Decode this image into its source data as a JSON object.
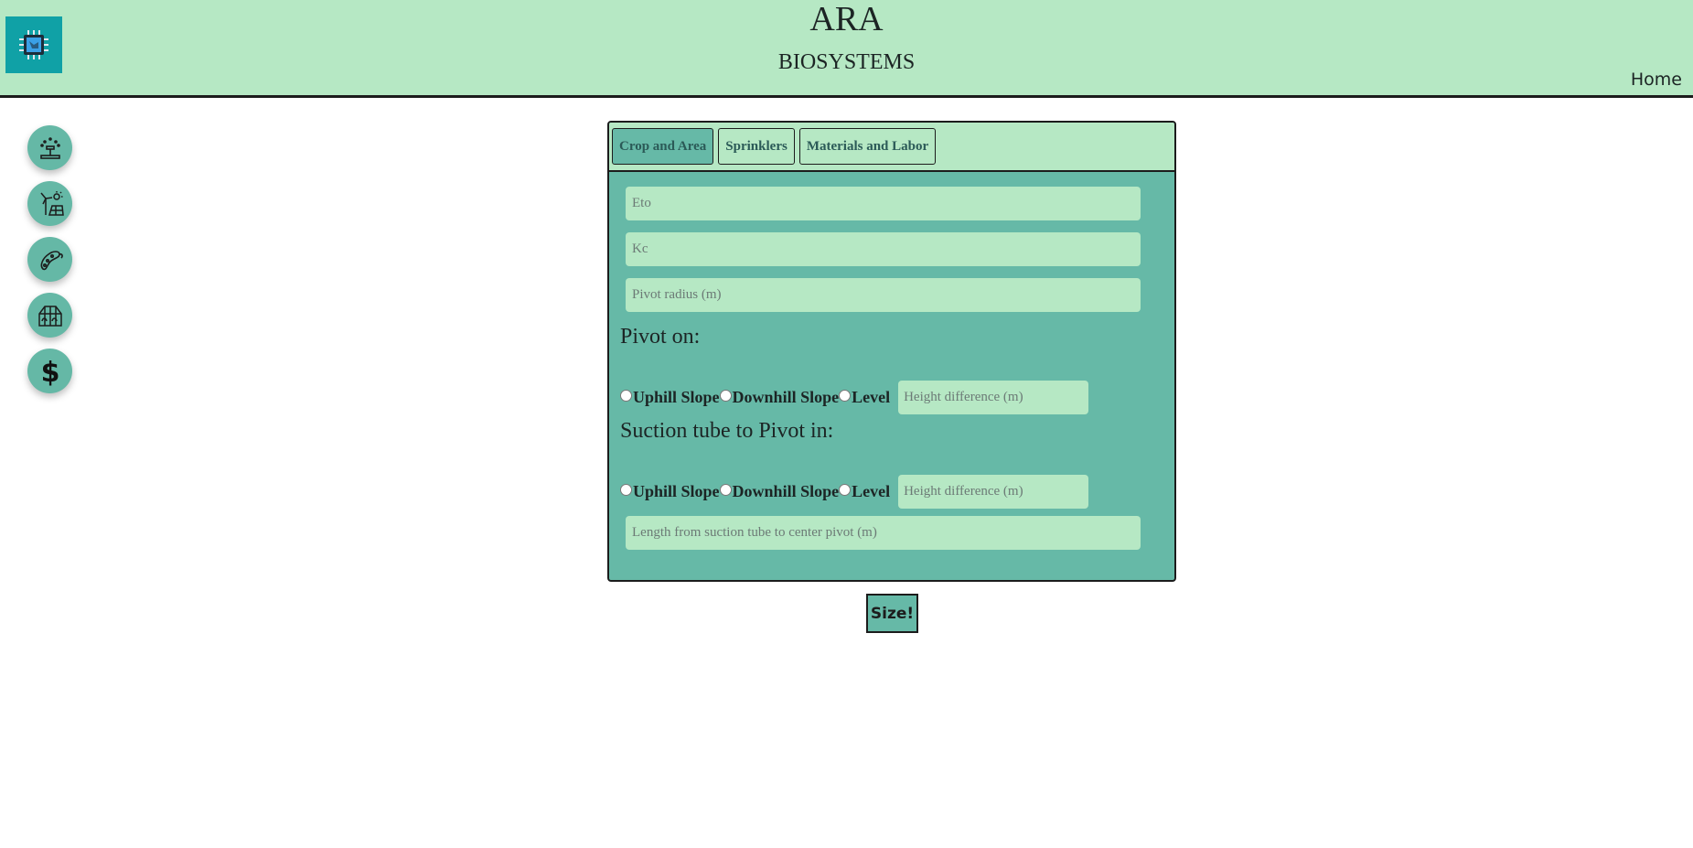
{
  "header": {
    "title": "ARA",
    "subtitle": "BIOSYSTEMS",
    "home_link": "Home",
    "logo_icon": "chip-icon"
  },
  "sidebar": {
    "items": [
      {
        "icon": "sprinkler-icon"
      },
      {
        "icon": "wind-solar-icon"
      },
      {
        "icon": "bacteria-icon"
      },
      {
        "icon": "greenhouse-icon"
      },
      {
        "icon": "dollar-icon"
      }
    ]
  },
  "tabs": [
    {
      "label": "Crop and Area",
      "active": true
    },
    {
      "label": "Sprinklers",
      "active": false
    },
    {
      "label": "Materials and Labor",
      "active": false
    }
  ],
  "form": {
    "eto_placeholder": "Eto",
    "kc_placeholder": "Kc",
    "pivot_radius_placeholder": "Pivot radius (m)",
    "pivot_on_title": "Pivot on:",
    "suction_title": "Suction tube to Pivot in:",
    "options": {
      "uphill": "Uphill Slope",
      "downhill": "Downhill Slope",
      "level": "Level"
    },
    "height_diff_placeholder": "Height difference (m)",
    "length_placeholder": "Length from suction tube to center pivot (m)"
  },
  "submit_label": "Size!",
  "colors": {
    "header_bg": "#b6e8c4",
    "panel_bg": "#66b9a7",
    "logo_bg": "#10a1a6"
  }
}
